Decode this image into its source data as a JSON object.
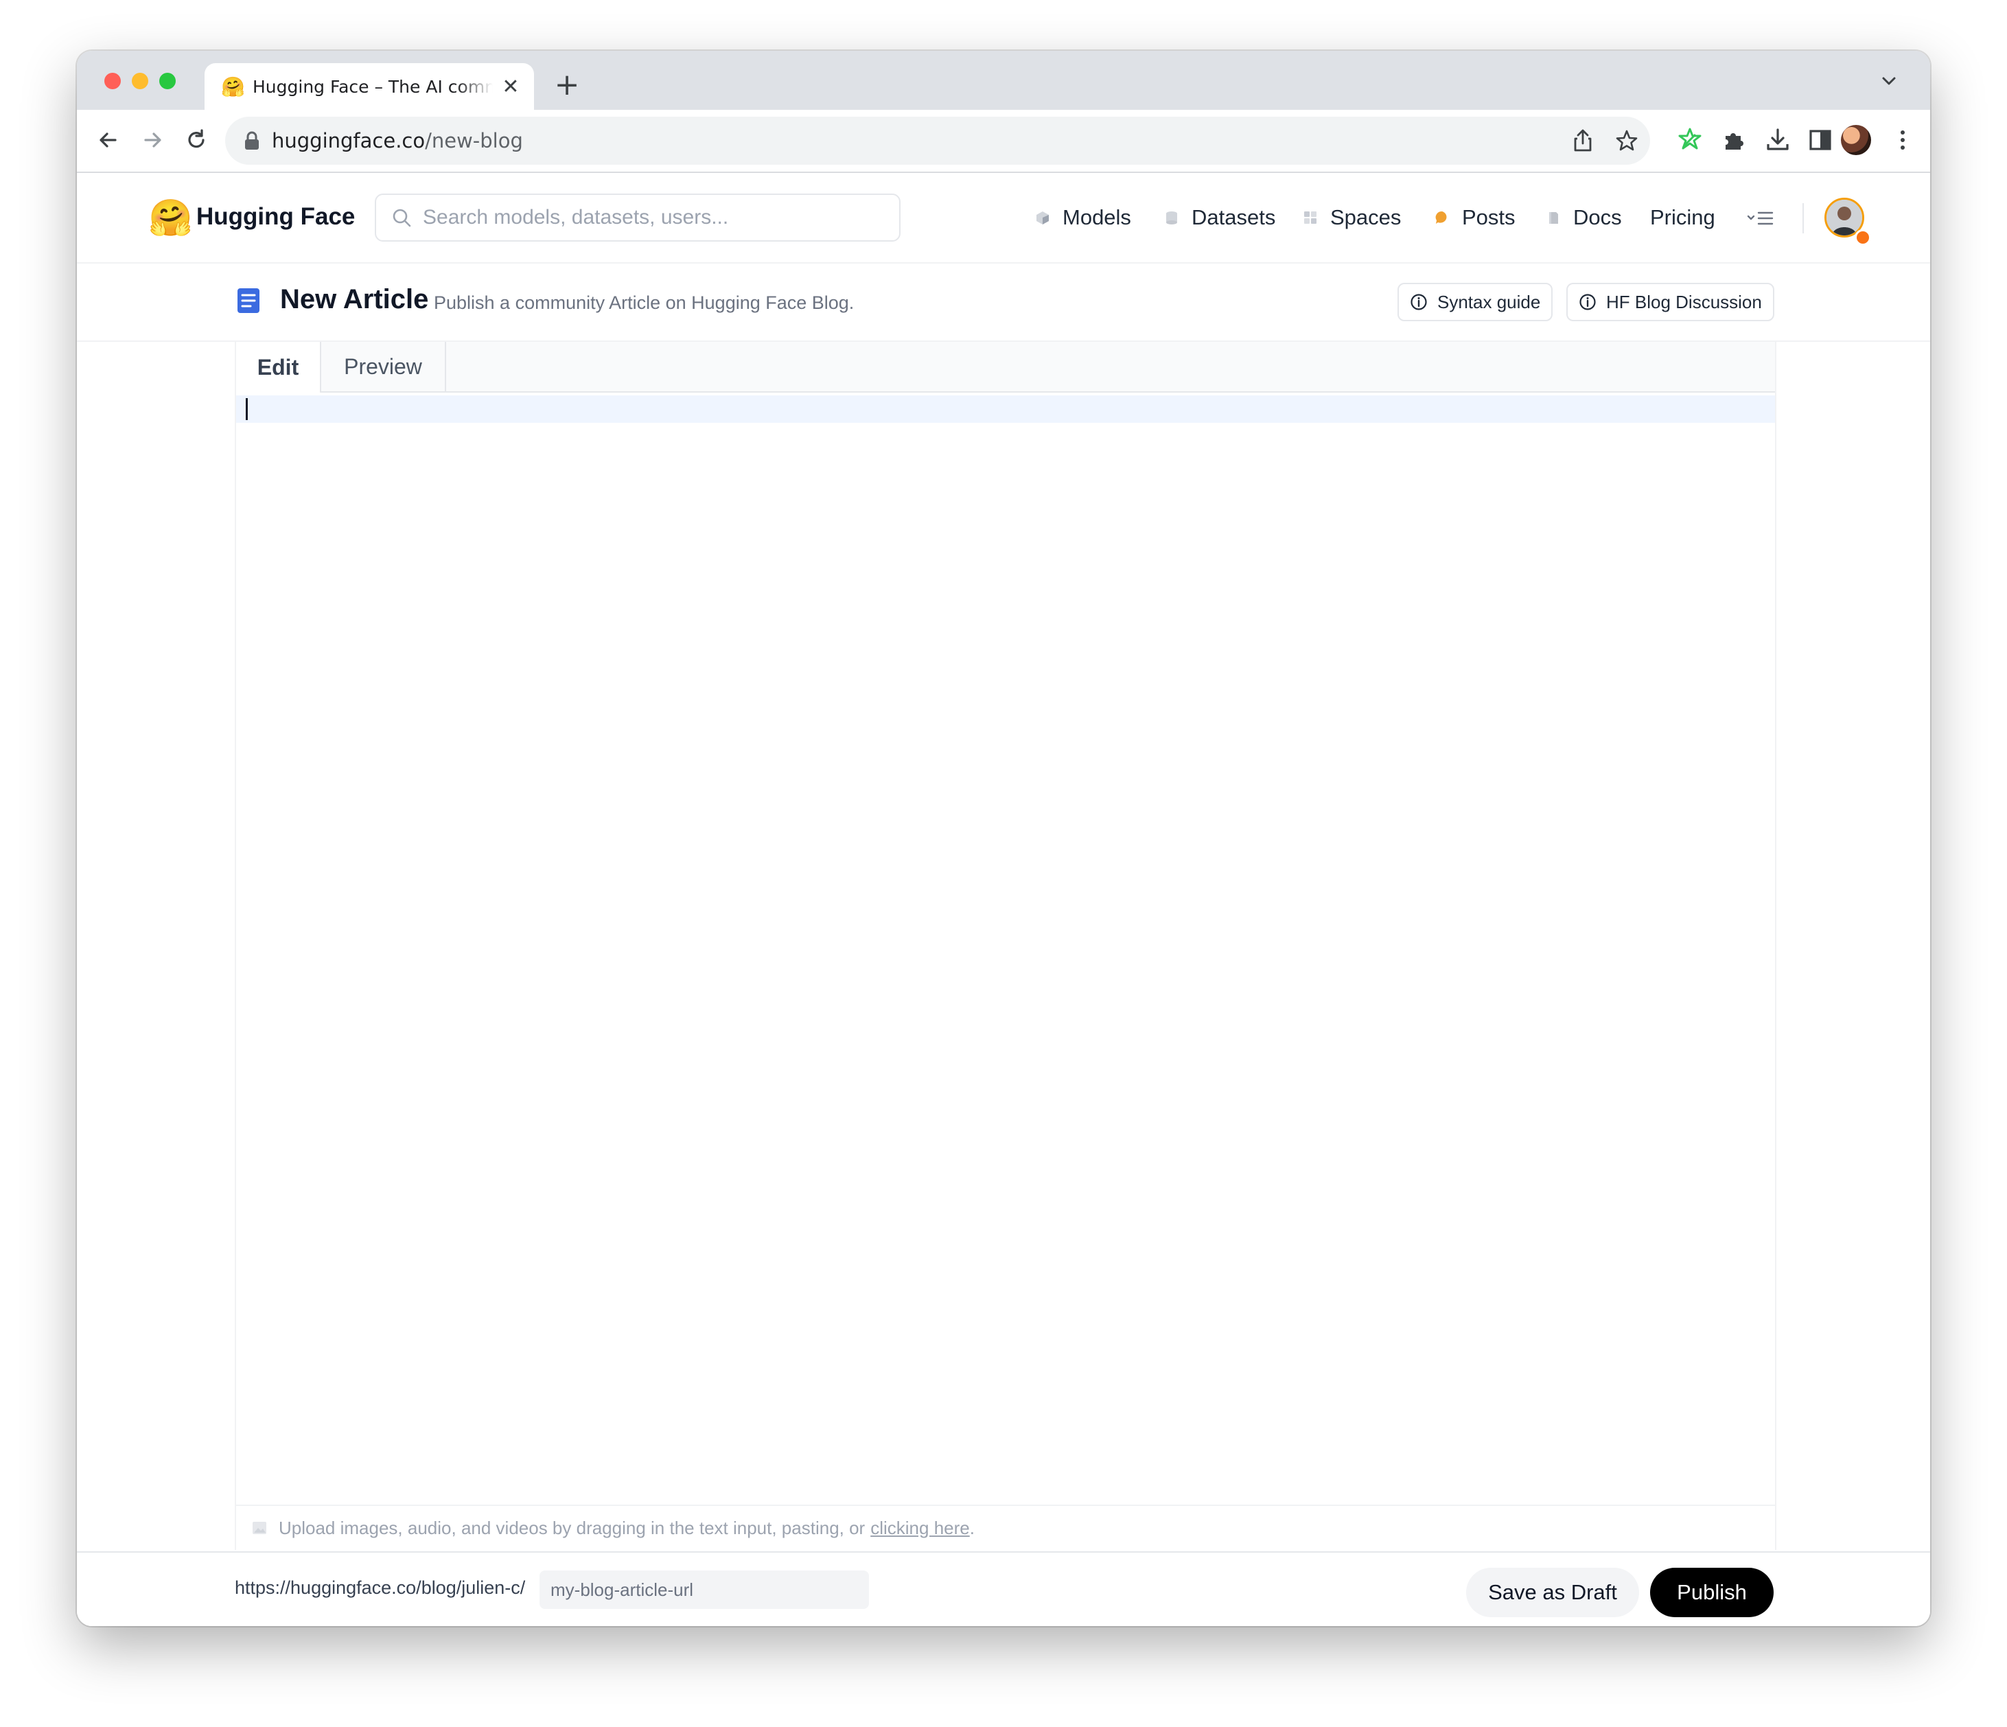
{
  "browser": {
    "tab": {
      "favicon": "🤗",
      "title": "Hugging Face – The AI community building the future.",
      "close": "✕"
    },
    "new_tab": "+",
    "address": {
      "host": "huggingface.co",
      "path": "/new-blog"
    },
    "icons": [
      "back-icon",
      "forward-icon",
      "reload-icon",
      "lock-icon",
      "share-icon",
      "star-icon",
      "extension-icon",
      "puzzle-icon",
      "download-icon",
      "sidepanel-icon",
      "profile-avatar",
      "kebab-menu-icon"
    ]
  },
  "hf_nav": {
    "logo": "🤗",
    "brand": "Hugging Face",
    "search_placeholder": "Search models, datasets, users...",
    "items": [
      {
        "label": "Models",
        "icon_color": "#9ca3af"
      },
      {
        "label": "Datasets",
        "icon_color": "#d1d5db"
      },
      {
        "label": "Spaces",
        "icon_color": "#c7cbd3"
      },
      {
        "label": "Posts",
        "icon_color": "#f0a030"
      },
      {
        "label": "Docs",
        "icon_color": "#c7cbd3"
      },
      {
        "label": "Pricing"
      }
    ]
  },
  "article": {
    "title": "New Article",
    "subtitle": "Publish a community Article on Hugging Face Blog.",
    "syntax_guide": "Syntax guide",
    "discussion": "HF Blog Discussion"
  },
  "editor": {
    "tabs": [
      "Edit",
      "Preview"
    ],
    "active_tab": "Edit",
    "content": "",
    "upload_text": "Upload images, audio, and videos by dragging in the text input, pasting, or",
    "upload_link": "clicking here",
    "upload_end": "."
  },
  "footer": {
    "url_prefix": "https://huggingface.co/blog/julien-c/",
    "slug_placeholder": "my-blog-article-url",
    "save_draft": "Save as Draft",
    "publish": "Publish"
  },
  "colors": {
    "accent_doc_icon": "#3b6be0",
    "publish_bg": "#000000",
    "extension_icon": "#34c759"
  }
}
